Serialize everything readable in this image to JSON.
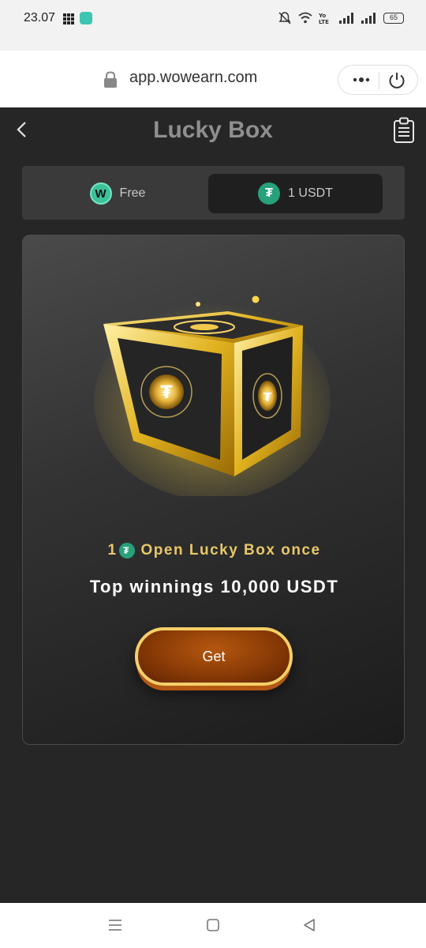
{
  "status": {
    "time": "23.07",
    "battery": "65"
  },
  "browser": {
    "url": "app.wowearn.com"
  },
  "header": {
    "title": "Lucky Box"
  },
  "tabs": [
    {
      "label": "Free",
      "icon": "w-coin-icon",
      "selected": false
    },
    {
      "label": "1 USDT",
      "icon": "tether-icon",
      "selected": true
    }
  ],
  "promo": {
    "cost_amount": "1",
    "cost_text": "Open Lucky Box once",
    "winnings_text": "Top winnings 10,000 USDT"
  },
  "actions": {
    "get_label": "Get"
  },
  "colors": {
    "accent_gold": "#e8c868",
    "tether_green": "#26a17b",
    "button_brown": "#8a3b06"
  }
}
